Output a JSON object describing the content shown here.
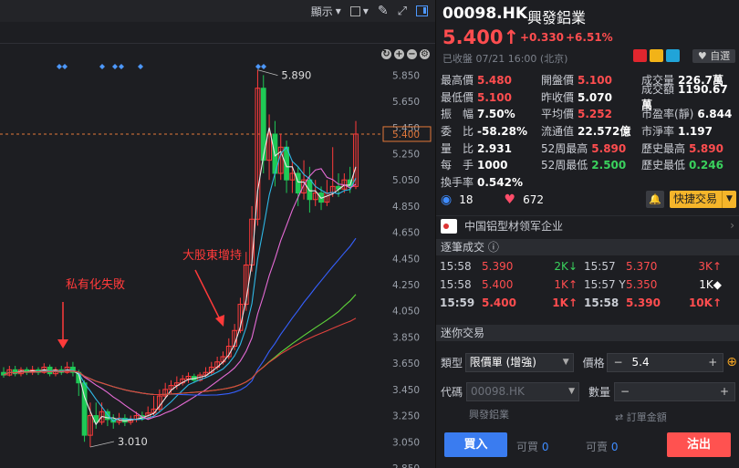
{
  "toolbar": {
    "display_label": "顯示"
  },
  "chart": {
    "price_labels": [
      "5.850",
      "5.650",
      "5.450",
      "5.250",
      "5.050",
      "4.850",
      "4.650",
      "4.450",
      "4.250",
      "4.050",
      "3.850",
      "3.650",
      "3.450",
      "3.250",
      "3.050",
      "2.850"
    ],
    "current_price_tag": "5.400",
    "high_marker": "5.890",
    "low_marker": "3.010",
    "annotation_privatization": "私有化失敗",
    "annotation_major_shareholder": "大股東增持",
    "colors": {
      "up": "#ff3b3b",
      "down": "#1fc956",
      "ma_white": "#e8e8e8",
      "ma_cyan": "#2eb8e6",
      "ma_pink": "#e66bd6",
      "ma_blue": "#3560ff",
      "ma_green": "#5fd53a",
      "ma_red": "#e0423d",
      "annotation": "#ff3a3a"
    }
  },
  "chart_data": {
    "type": "candlestick",
    "ylim": [
      2.85,
      5.95
    ],
    "high": 5.89,
    "low": 3.01,
    "last": 5.4,
    "candles": [
      [
        3.58,
        3.56,
        3.62,
        3.54
      ],
      [
        3.56,
        3.6,
        3.63,
        3.55
      ],
      [
        3.6,
        3.57,
        3.63,
        3.55
      ],
      [
        3.57,
        3.6,
        3.62,
        3.55
      ],
      [
        3.6,
        3.58,
        3.62,
        3.56
      ],
      [
        3.58,
        3.6,
        3.63,
        3.56
      ],
      [
        3.6,
        3.58,
        3.62,
        3.56
      ],
      [
        3.58,
        3.62,
        3.65,
        3.57
      ],
      [
        3.62,
        3.57,
        3.64,
        3.55
      ],
      [
        3.57,
        3.6,
        3.62,
        3.55
      ],
      [
        3.6,
        3.58,
        3.63,
        3.56
      ],
      [
        3.58,
        3.62,
        3.66,
        3.57
      ],
      [
        3.62,
        3.58,
        3.66,
        3.55
      ],
      [
        3.58,
        3.5,
        3.6,
        3.4
      ],
      [
        3.5,
        3.1,
        3.52,
        3.05
      ],
      [
        3.1,
        3.25,
        3.35,
        3.01
      ],
      [
        3.25,
        3.2,
        3.35,
        3.15
      ],
      [
        3.2,
        3.28,
        3.35,
        3.18
      ],
      [
        3.28,
        3.22,
        3.3,
        3.17
      ],
      [
        3.22,
        3.2,
        3.26,
        3.15
      ],
      [
        3.2,
        3.23,
        3.27,
        3.18
      ],
      [
        3.23,
        3.2,
        3.26,
        3.17
      ],
      [
        3.2,
        3.22,
        3.25,
        3.18
      ],
      [
        3.22,
        3.25,
        3.28,
        3.2
      ],
      [
        3.25,
        3.23,
        3.28,
        3.21
      ],
      [
        3.23,
        3.27,
        3.32,
        3.22
      ],
      [
        3.27,
        3.3,
        3.4,
        3.25
      ],
      [
        3.3,
        3.4,
        3.45,
        3.28
      ],
      [
        3.4,
        3.45,
        3.5,
        3.38
      ],
      [
        3.45,
        3.48,
        3.52,
        3.42
      ],
      [
        3.48,
        3.5,
        3.55,
        3.45
      ],
      [
        3.5,
        3.53,
        3.56,
        3.48
      ],
      [
        3.53,
        3.55,
        3.58,
        3.5
      ],
      [
        3.55,
        3.52,
        3.57,
        3.5
      ],
      [
        3.52,
        3.56,
        3.58,
        3.51
      ],
      [
        3.56,
        3.58,
        3.62,
        3.54
      ],
      [
        3.58,
        3.62,
        3.66,
        3.56
      ],
      [
        3.62,
        3.66,
        3.7,
        3.6
      ],
      [
        3.66,
        3.7,
        3.74,
        3.64
      ],
      [
        3.7,
        3.78,
        3.84,
        3.68
      ],
      [
        3.78,
        3.9,
        3.95,
        3.75
      ],
      [
        3.9,
        4.1,
        4.15,
        3.88
      ],
      [
        4.1,
        4.4,
        4.5,
        4.05
      ],
      [
        4.4,
        4.75,
        4.85,
        4.35
      ],
      [
        4.75,
        5.75,
        5.89,
        4.7
      ],
      [
        5.75,
        5.2,
        5.85,
        5.1
      ],
      [
        5.2,
        5.4,
        5.55,
        5.05
      ],
      [
        5.4,
        5.1,
        5.5,
        5.0
      ],
      [
        5.1,
        5.3,
        5.4,
        5.05
      ],
      [
        5.3,
        5.05,
        5.35,
        4.95
      ],
      [
        5.05,
        5.1,
        5.2,
        4.95
      ],
      [
        5.1,
        4.95,
        5.15,
        4.85
      ],
      [
        4.95,
        5.05,
        5.2,
        4.9
      ],
      [
        5.05,
        4.9,
        5.15,
        4.8
      ],
      [
        4.9,
        4.95,
        5.05,
        4.85
      ],
      [
        4.95,
        4.88,
        5.0,
        4.82
      ],
      [
        4.88,
        4.95,
        5.05,
        4.85
      ],
      [
        4.95,
        5.0,
        5.3,
        4.92
      ],
      [
        5.0,
        4.98,
        5.1,
        4.92
      ],
      [
        4.98,
        5.05,
        5.1,
        4.95
      ],
      [
        5.05,
        5.0,
        5.15,
        4.95
      ],
      [
        5.0,
        5.4,
        5.5,
        4.98
      ]
    ]
  },
  "quote": {
    "code": "00098.HK",
    "name": "興發鋁業",
    "price": "5.400",
    "change": "+0.330",
    "change_pct": "+6.51%",
    "status": "已收盤 07/21 16:00 (北京)",
    "fav_label": "自選",
    "stats": [
      [
        [
          "最高價",
          "5.480",
          "red"
        ],
        [
          "開盤價",
          "5.100",
          "red"
        ],
        [
          "成交量",
          "226.7萬",
          "white"
        ]
      ],
      [
        [
          "最低價",
          "5.100",
          "red"
        ],
        [
          "昨收價",
          "5.070",
          "white"
        ],
        [
          "成交額",
          "1190.67萬",
          "white"
        ]
      ],
      [
        [
          "振　幅",
          "7.50%",
          "white"
        ],
        [
          "平均價",
          "5.252",
          "red"
        ],
        [
          "市盈率(靜)",
          "6.844",
          "white"
        ]
      ],
      [
        [
          "委　比",
          "-58.28%",
          "white"
        ],
        [
          "流通值",
          "22.572億",
          "white"
        ],
        [
          "市淨率",
          "1.197",
          "white"
        ]
      ],
      [
        [
          "量　比",
          "2.931",
          "white"
        ],
        [
          "52周最高",
          "5.890",
          "red"
        ],
        [
          "歷史最高",
          "5.890",
          "red"
        ]
      ],
      [
        [
          "每　手",
          "1000",
          "white"
        ],
        [
          "52周最低",
          "2.500",
          "green"
        ],
        [
          "歷史最低",
          "0.246",
          "green"
        ]
      ],
      [
        [
          "換手率",
          "0.542%",
          "white"
        ]
      ]
    ],
    "watchers": "18",
    "likes": "672",
    "quick_trade": "快捷交易",
    "sector": "中国铝型材领军企业"
  },
  "ticks": {
    "title": "逐筆成交",
    "rows": [
      [
        "15:58",
        "5.390",
        "2K",
        "green",
        "↓",
        "15:57",
        "5.370",
        "3K",
        "red",
        "↑"
      ],
      [
        "15:58",
        "5.400",
        "1K",
        "red",
        "↑",
        "15:57 Y",
        "5.350",
        "1K",
        "white",
        "◆"
      ],
      [
        "15:59",
        "5.400",
        "1K",
        "red",
        "↑",
        "15:58",
        "5.390",
        "10K",
        "red",
        "↑"
      ]
    ]
  },
  "mini": {
    "title": "迷你交易",
    "type_label": "類型",
    "type_value": "限價單 (增強)",
    "price_label": "價格",
    "price_value": "5.4",
    "code_label": "代碼",
    "code_value": "00098.HK",
    "code_sub": "興發鋁業",
    "qty_label": "數量",
    "order_amount": "訂單金額",
    "buy_label": "買入",
    "sell_label": "沽出",
    "can_buy_label": "可買",
    "can_buy_value": "0",
    "can_sell_label": "可賣",
    "can_sell_value": "0"
  }
}
